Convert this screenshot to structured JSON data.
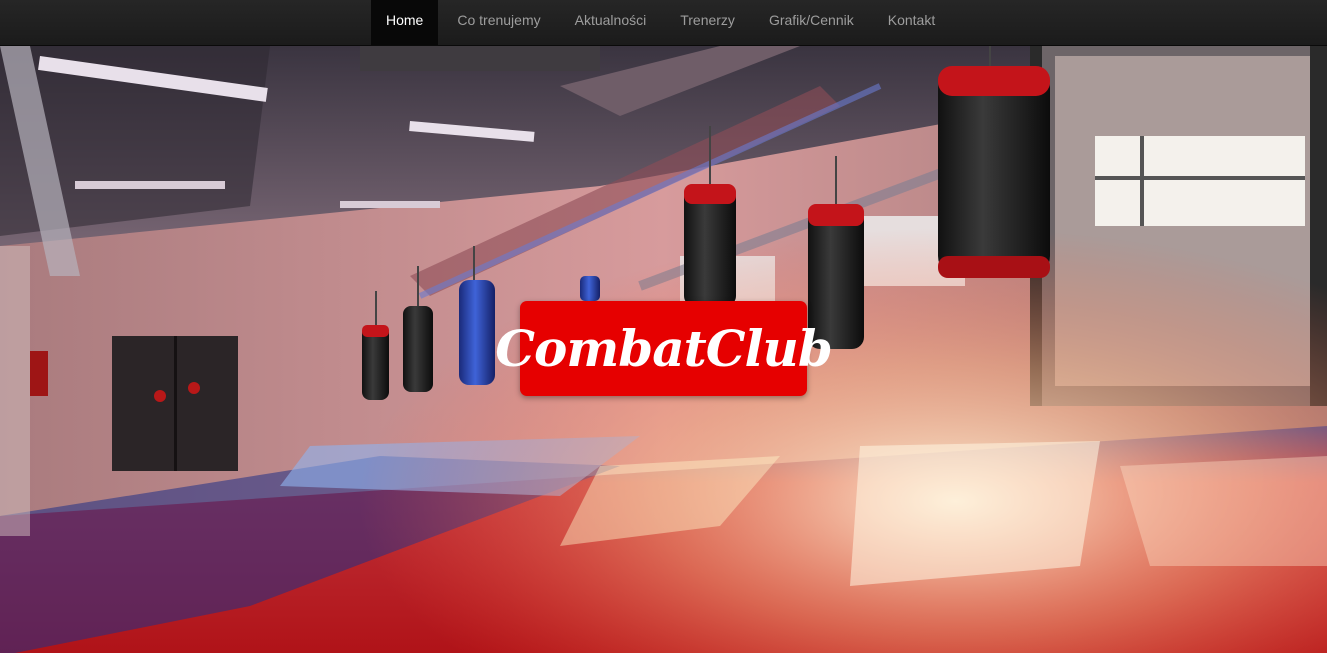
{
  "nav": {
    "items": [
      {
        "label": "Home",
        "active": true
      },
      {
        "label": "Co trenujemy",
        "active": false
      },
      {
        "label": "Aktualności",
        "active": false
      },
      {
        "label": "Trenerzy",
        "active": false
      },
      {
        "label": "Grafik/Cennik",
        "active": false
      },
      {
        "label": "Kontakt",
        "active": false
      }
    ]
  },
  "hero": {
    "brand": "CombatClub",
    "brand_color": "#e60000"
  }
}
